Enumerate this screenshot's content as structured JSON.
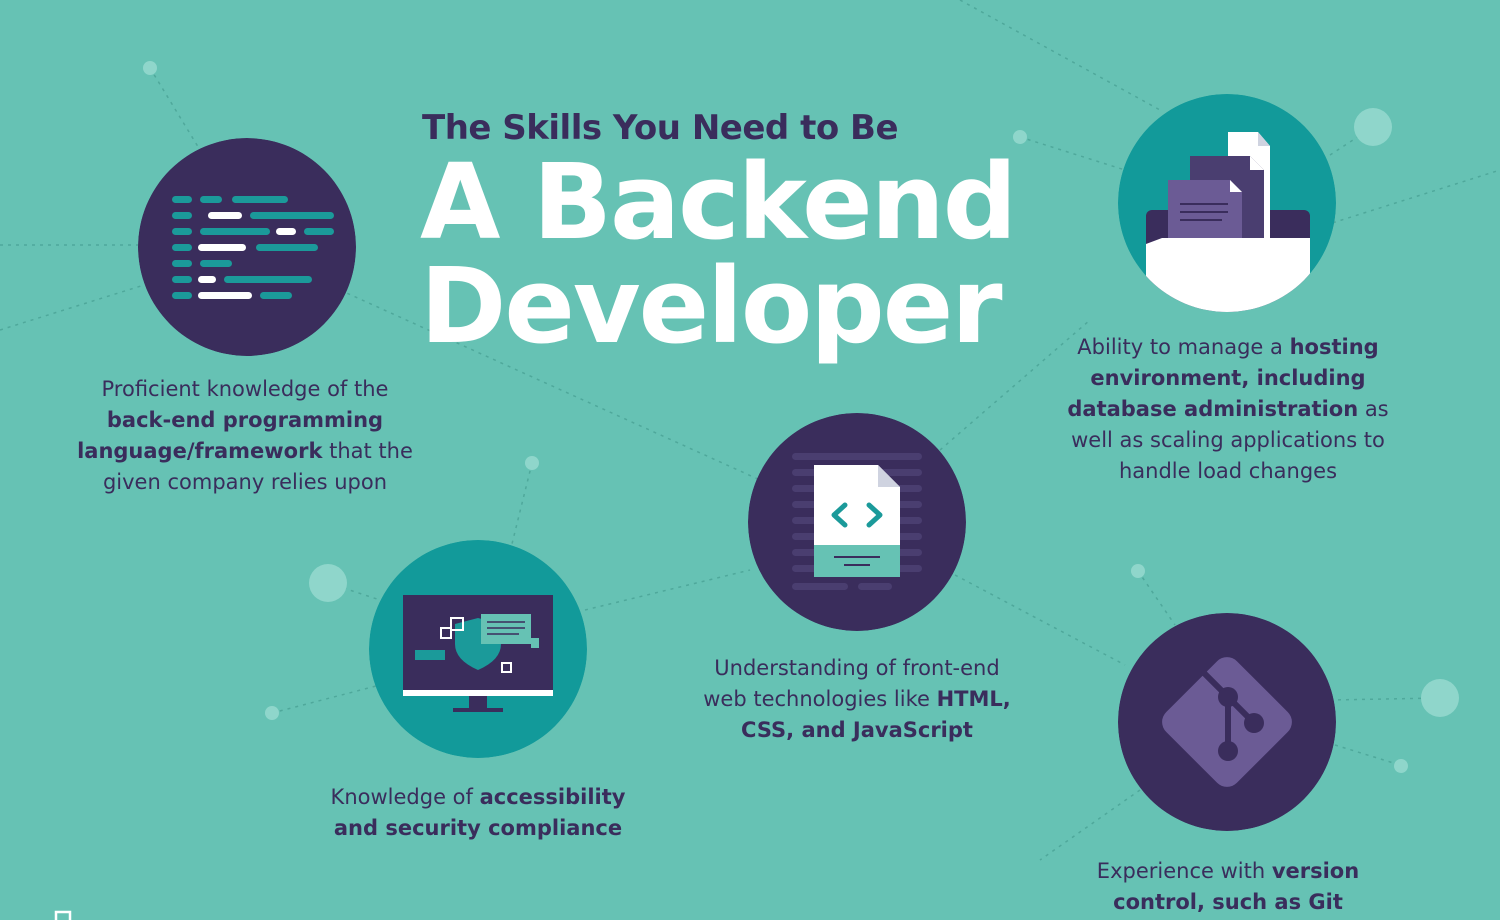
{
  "header": {
    "subtitle": "The Skills You Need to Be",
    "title_line1": "A Backend",
    "title_line2": "Developer"
  },
  "colors": {
    "background": "#66c2b4",
    "dark_purple": "#3a2d5c",
    "teal": "#129a9a",
    "white": "#ffffff"
  },
  "skills": [
    {
      "icon": "code-editor-icon",
      "parts": [
        {
          "text": "Proficient knowledge of the ",
          "bold": false
        },
        {
          "text": "back-end programming language/framework",
          "bold": true
        },
        {
          "text": " that the given company relies upon",
          "bold": false
        }
      ]
    },
    {
      "icon": "database-folder-icon",
      "parts": [
        {
          "text": "Ability to manage a ",
          "bold": false
        },
        {
          "text": "hosting environment, including database administration",
          "bold": true
        },
        {
          "text": " as well as scaling applications to handle load changes",
          "bold": false
        }
      ]
    },
    {
      "icon": "html-file-icon",
      "parts": [
        {
          "text": "Understanding of front-end web technologies like ",
          "bold": false
        },
        {
          "text": "HTML, CSS, and JavaScript",
          "bold": true
        }
      ]
    },
    {
      "icon": "security-monitor-icon",
      "parts": [
        {
          "text": "Knowledge of ",
          "bold": false
        },
        {
          "text": "accessibility and security compliance",
          "bold": true
        }
      ]
    },
    {
      "icon": "git-icon",
      "parts": [
        {
          "text": "Experience with ",
          "bold": false
        },
        {
          "text": "version control, such as Git",
          "bold": true
        }
      ]
    }
  ]
}
